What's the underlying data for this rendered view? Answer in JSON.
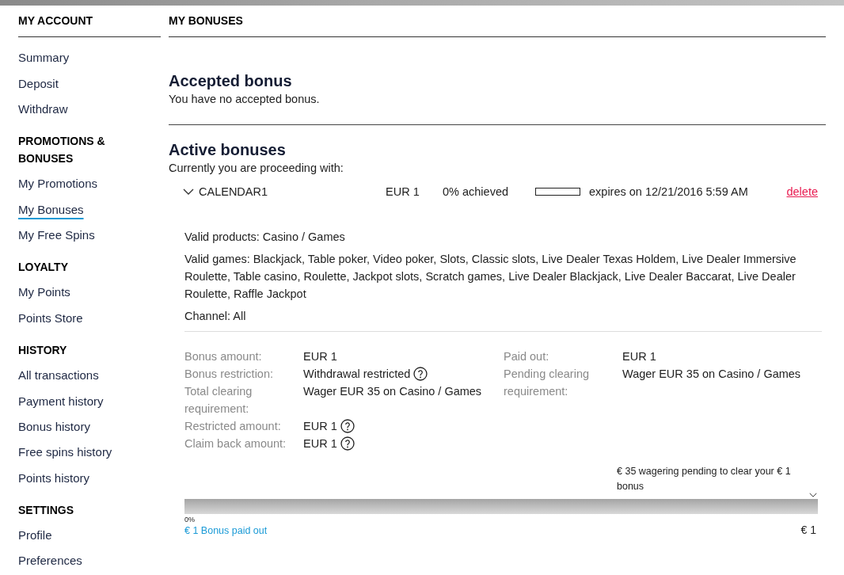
{
  "sidebar": {
    "title": "MY ACCOUNT",
    "groups": [
      {
        "items": [
          {
            "label": "Summary",
            "selected": false
          },
          {
            "label": "Deposit",
            "selected": false
          },
          {
            "label": "Withdraw",
            "selected": false
          }
        ]
      },
      {
        "heading": "PROMOTIONS & BONUSES",
        "items": [
          {
            "label": "My Promotions",
            "selected": false
          },
          {
            "label": "My Bonuses",
            "selected": true
          },
          {
            "label": "My Free Spins",
            "selected": false
          }
        ]
      },
      {
        "heading": "LOYALTY",
        "items": [
          {
            "label": "My Points",
            "selected": false
          },
          {
            "label": "Points Store",
            "selected": false
          }
        ]
      },
      {
        "heading": "HISTORY",
        "items": [
          {
            "label": "All transactions",
            "selected": false
          },
          {
            "label": "Payment history",
            "selected": false
          },
          {
            "label": "Bonus history",
            "selected": false
          },
          {
            "label": "Free spins history",
            "selected": false
          },
          {
            "label": "Points history",
            "selected": false
          }
        ]
      },
      {
        "heading": "SETTINGS",
        "items": [
          {
            "label": "Profile",
            "selected": false
          },
          {
            "label": "Preferences",
            "selected": false
          }
        ]
      }
    ]
  },
  "page": {
    "title": "MY BONUSES"
  },
  "accepted": {
    "heading": "Accepted bonus",
    "message": "You have no accepted bonus."
  },
  "active": {
    "heading": "Active bonuses",
    "intro": "Currently you are proceeding with:",
    "bonuses": [
      {
        "name": "CALENDAR1",
        "expanded": true,
        "amount": "EUR 1",
        "achieved": "0% achieved",
        "level": 0,
        "expires": "expires on 12/21/2016 5:59 AM",
        "action": "delete",
        "details": [
          "Valid products: Casino / Games",
          "Valid games: Blackjack, Table poker, Video poker, Slots, Classic slots, Live Dealer Texas Holdem, Live Dealer Immersive Roulette, Table casino, Roulette, Jackpot slots, Scratch games, Live Dealer Blackjack, Live Dealer Baccarat, Live Dealer Roulette, Raffle Jackpot",
          "Channel: All"
        ],
        "fact_columns": [
          [
            {
              "label": "Bonus amount:",
              "value": "EUR 1",
              "help": false
            },
            {
              "label": "Bonus restriction:",
              "value": "Withdrawal restricted",
              "help": true
            },
            {
              "label": "Total clearing requirement:",
              "value": "Wager EUR 35 on Casino / Games",
              "help": false
            },
            {
              "label": "Restricted amount:",
              "value": "EUR 1",
              "help": true
            },
            {
              "label": "Claim back amount:",
              "value": "EUR 1",
              "help": true
            }
          ],
          [
            {
              "label": "Paid out:",
              "value": "EUR 1",
              "help": false
            },
            {
              "label": "Pending clearing requirement:",
              "value": "Wager EUR 35 on Casino / Games",
              "help": false
            }
          ]
        ],
        "wagering": {
          "note": "€ 35 wagering pending to clear your € 1 bonus",
          "level": 0,
          "start": "0%",
          "paid_out": "€ 1 Bonus paid out",
          "end": "€ 1"
        }
      }
    ]
  }
}
